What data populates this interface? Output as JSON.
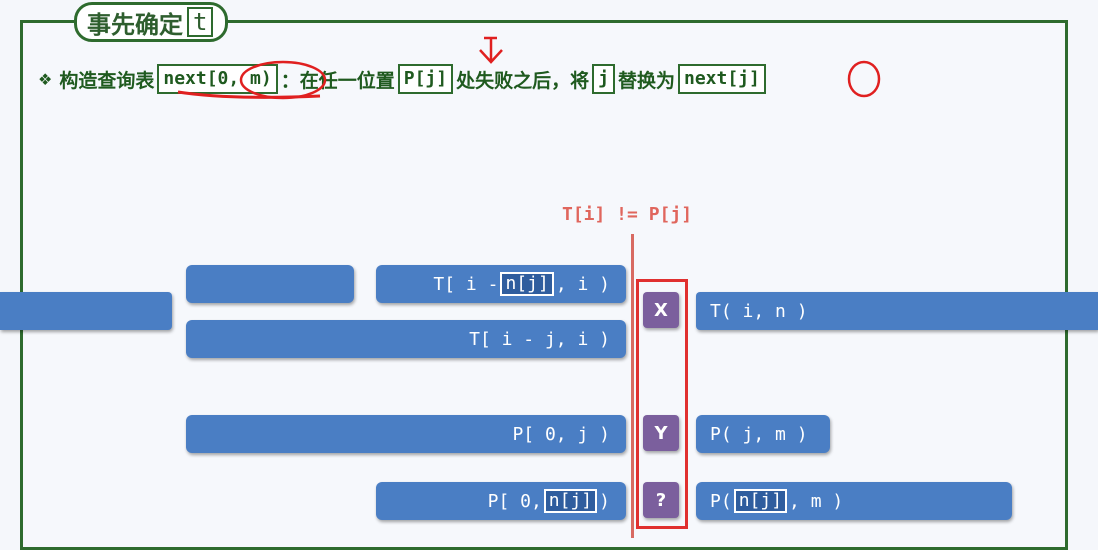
{
  "header": {
    "title": "事先确定",
    "title_var": "t"
  },
  "subtitle": {
    "bullet": "❖",
    "p1": "构造查询表",
    "box1": "next[0, m)",
    "p2": "：在任一位置",
    "box2": "P[j]",
    "p3": "处失败之后，将",
    "box3": "j",
    "p4": "替换为",
    "box4": "next[j]"
  },
  "mismatch_label": "T[i] != P[j]",
  "rows": {
    "t_left_suffix": {
      "pre": "T[ i - ",
      "inner": "n[j]",
      "post": ", i )"
    },
    "t_suffix": "T[ i - j, i )",
    "t_rest": "T( i, n )",
    "p_prefix": "P[ 0, j )",
    "p_rest": "P( j, m )",
    "p_new_prefix": {
      "pre": "P[ 0, ",
      "inner": "n[j]",
      "post": " )"
    },
    "p_new_rest": {
      "pre": "P( ",
      "inner": "n[j]",
      "post": ", m )"
    }
  },
  "badges": {
    "x": "X",
    "y": "Y",
    "q": "?"
  },
  "colors": {
    "frame_green": "#2e6b2e",
    "bar_blue": "#4a7ec4",
    "badge_purple": "#7b5f9d",
    "highlight_red": "#e03030"
  }
}
